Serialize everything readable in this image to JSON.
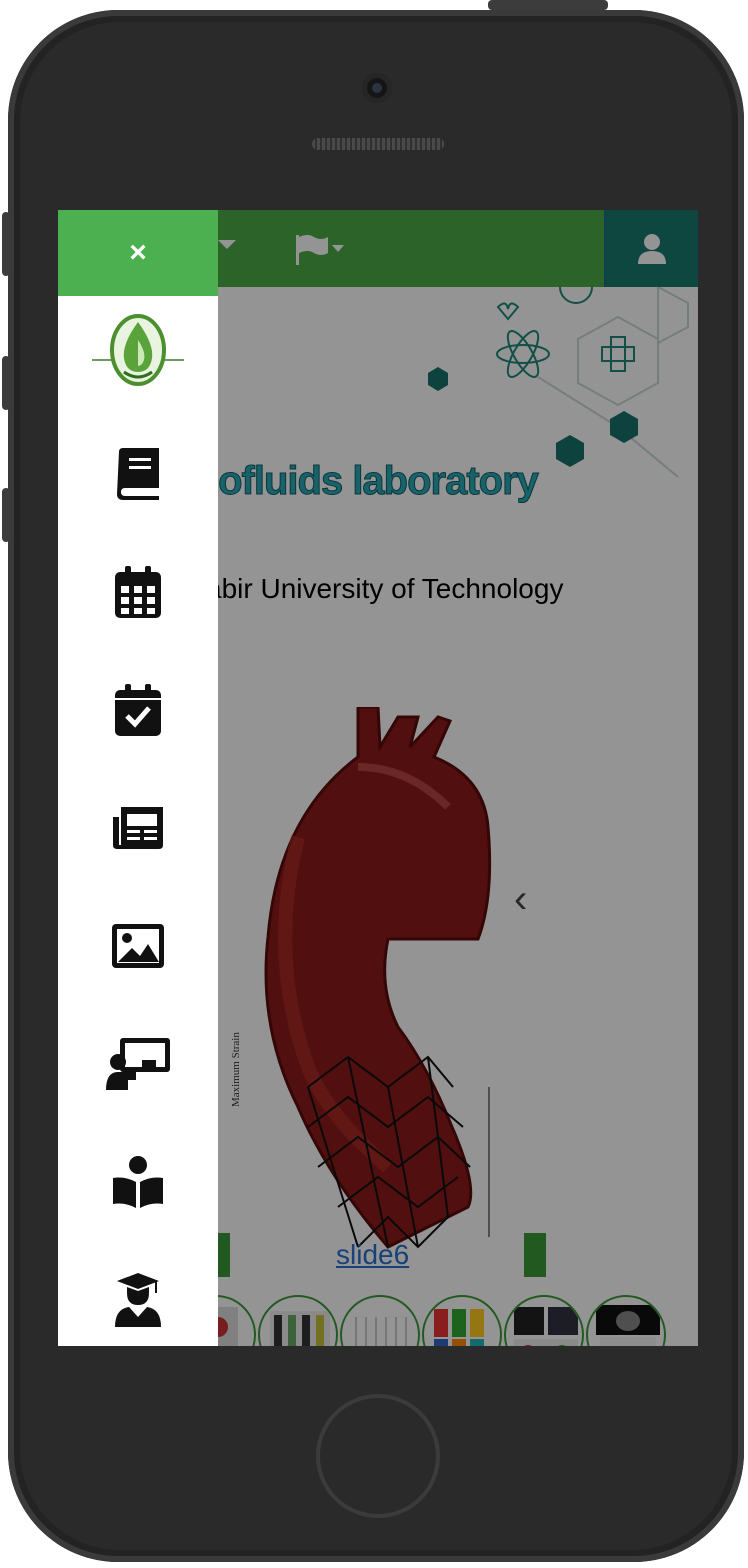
{
  "header": {
    "close_label": "×",
    "user_icon": "user-icon",
    "flag_icon": "flag-icon"
  },
  "hero": {
    "title": "iofluids laboratory",
    "subtitle": "abir University of Technology"
  },
  "slider": {
    "caption": "slide6",
    "chart_axis_label": "Maximum Strain",
    "thumbnails_count": 6
  },
  "drawer": {
    "items": [
      {
        "icon": "book-icon"
      },
      {
        "icon": "calendar-icon"
      },
      {
        "icon": "calendar-check-icon"
      },
      {
        "icon": "newspaper-icon"
      },
      {
        "icon": "image-icon"
      },
      {
        "icon": "teacher-icon"
      },
      {
        "icon": "book-reader-icon"
      },
      {
        "icon": "graduate-icon"
      }
    ]
  },
  "colors": {
    "nav_green": "#4aab47",
    "drawer_close_green": "#4cb050",
    "user_teal": "#177a6e",
    "title_teal": "#2aa9b6"
  }
}
